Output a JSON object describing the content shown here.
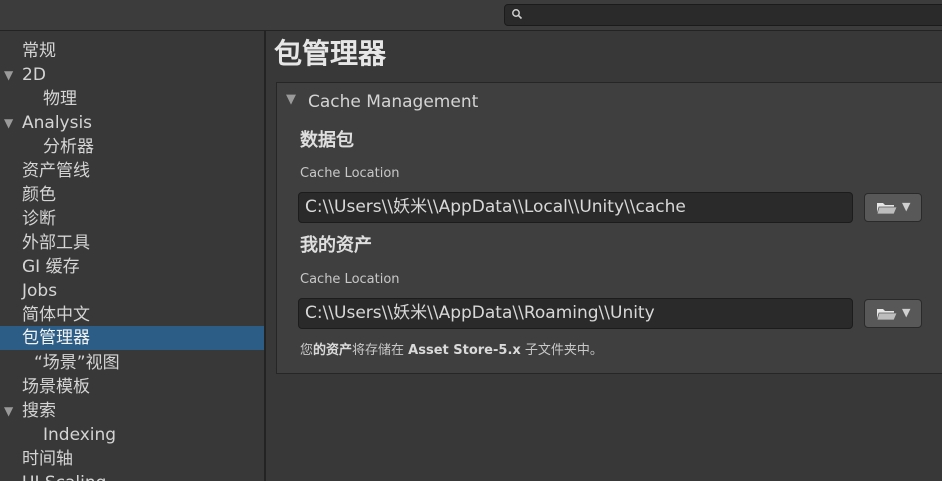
{
  "search": {
    "placeholder": ""
  },
  "sidebar": {
    "items": [
      {
        "label": "常规"
      },
      {
        "label": "2D",
        "arrow": "▼"
      },
      {
        "label": "物理"
      },
      {
        "label": "Analysis",
        "arrow": "▼"
      },
      {
        "label": "分析器"
      },
      {
        "label": "资产管线"
      },
      {
        "label": "颜色"
      },
      {
        "label": "诊断"
      },
      {
        "label": "外部工具"
      },
      {
        "label": "GI 缓存"
      },
      {
        "label": "Jobs"
      },
      {
        "label": "简体中文"
      },
      {
        "label": "包管理器",
        "selected": true
      },
      {
        "label": "“场景”视图"
      },
      {
        "label": "场景模板"
      },
      {
        "label": "搜索",
        "arrow": "▼"
      },
      {
        "label": "Indexing"
      },
      {
        "label": "时间轴"
      },
      {
        "label": "UI Scaling"
      }
    ]
  },
  "main": {
    "title": "包管理器",
    "foldout": {
      "arrow": "▼",
      "title": "Cache Management"
    },
    "packages": {
      "title": "数据包",
      "location_label": "Cache Location",
      "path": "C:\\\\Users\\\\妖米\\\\AppData\\\\Local\\\\Unity\\\\cache"
    },
    "assets": {
      "title": "我的资产",
      "location_label": "Cache Location",
      "path": "C:\\\\Users\\\\妖米\\\\AppData\\\\Roaming\\\\Unity"
    },
    "note": {
      "prefix": "您",
      "bold1": "的资产",
      "middle": "将存储在 ",
      "bold2": "Asset Store-5.x",
      "suffix": " 子文件夹中。"
    },
    "folder_caret": "▼"
  }
}
